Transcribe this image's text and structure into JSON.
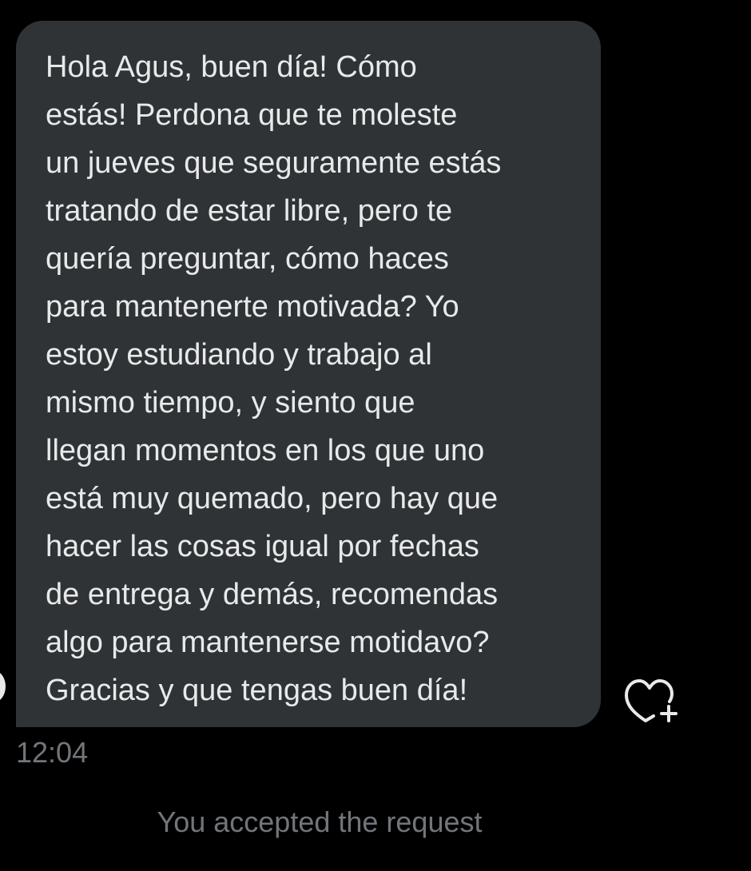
{
  "message": {
    "lines": [
      "Hola Agus, buen día! Cómo",
      "estás! Perdona que te moleste",
      "un jueves que seguramente estás",
      "tratando de estar libre, pero te",
      "quería preguntar, cómo haces",
      "para mantenerte motivada? Yo",
      "estoy estudiando y trabajo al",
      "mismo tiempo, y siento que",
      "llegan momentos en los que uno",
      "está muy quemado, pero hay que",
      "hacer las cosas igual por fechas",
      "de entrega y demás, recomendas",
      "algo para mantenerse motidavo?",
      "Gracias y que tengas buen día!"
    ],
    "timestamp": "12:04"
  },
  "reaction": {
    "icon": "heart-plus-icon"
  },
  "status": {
    "text": "You accepted the request"
  },
  "colors": {
    "background": "#000000",
    "bubble": "#2f3336",
    "message_text": "#e7e9ea",
    "muted_text": "#71767b",
    "icon": "#e7e9ea"
  }
}
